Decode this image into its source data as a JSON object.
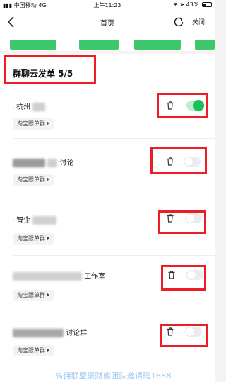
{
  "status_bar": {
    "carrier": "中国移动",
    "network": "4G",
    "time": "上午11:23",
    "battery_percent": "43%",
    "battery_level": 0.43
  },
  "nav": {
    "title": "首页",
    "close_label": "关闭"
  },
  "group": {
    "title": "群聊云发单 5/5",
    "rows": [
      {
        "name_prefix": "杭州",
        "name_suffix": "",
        "tag_label": "淘宝跟单群",
        "enabled": true
      },
      {
        "name_prefix": "",
        "name_suffix": "讨论",
        "tag_label": "淘宝跟单群",
        "enabled": false
      },
      {
        "name_prefix": "智企",
        "name_suffix": "",
        "tag_label": "淘宝跟单群",
        "enabled": false
      },
      {
        "name_prefix": "",
        "name_suffix": "工作室",
        "tag_label": "淘宝跟单群",
        "enabled": false
      },
      {
        "name_prefix": "",
        "name_suffix": "讨论群",
        "tag_label": "淘宝跟单群",
        "enabled": false
      }
    ]
  },
  "watermark": "高佣联盟聚财熊团队邀请码1688",
  "colors": {
    "accent_green": "#18c25b",
    "highlight_red": "#ee1c25",
    "watermark_blue": "#9ec7ee"
  }
}
